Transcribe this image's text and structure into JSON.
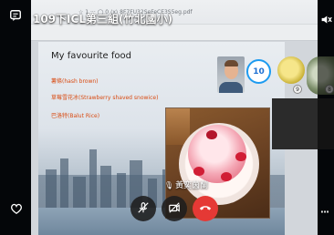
{
  "meeting": {
    "title": "109下ICL第三組(竹北國小)",
    "browser_url": "☆ 1  ··· ◯ 0  ⟨x⟩ 8F7FU32SeFeCE3S5eg.pdf"
  },
  "slide": {
    "title": "My favourite food",
    "items": [
      "薯條(hash brown)",
      "草莓雪花冰(Strawberry shaved snowice)",
      "巴洛特(Balut Rice)"
    ]
  },
  "participants": {
    "count_badge": "10",
    "mini_badge_1": "9",
    "mini_badge_2": "8"
  },
  "speaker": {
    "name": "黃奕茵蘭"
  },
  "controls": {
    "mic_icon": "mic-off-icon",
    "camera_icon": "camera-off-icon",
    "end_call_icon": "phone-hangup-icon",
    "end_call_color": "#e53935"
  },
  "colors": {
    "accent": "#1d9bf0",
    "slide_text_orange": "#d94b12"
  }
}
